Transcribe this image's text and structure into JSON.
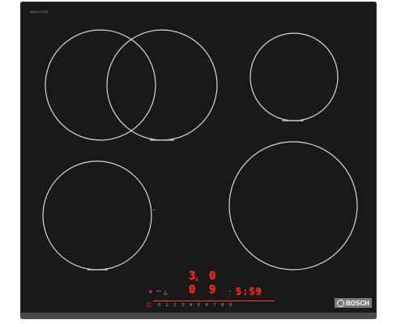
{
  "brand": {
    "top_left_line1": "INDUCTION",
    "top_left_line2": "",
    "top_right_line1": "",
    "top_right_line2": "",
    "logo_text": "BOSCH"
  },
  "colors": {
    "glass": "#191919",
    "zone_outline": "#d9d9d9",
    "display_red": "#ff2a2a",
    "logo_bg": "#7a7a7a"
  },
  "zones": [
    {
      "name": "front-left-flex-zone-a"
    },
    {
      "name": "front-left-flex-zone-b"
    },
    {
      "name": "top-right-zone"
    },
    {
      "name": "bottom-left-zone"
    },
    {
      "name": "bottom-right-zone"
    }
  ],
  "displays": {
    "top_left_level": "3",
    "top_left_sub": "A",
    "top_right_level": "0",
    "bottom_left_level": "0",
    "bottom_right_level": "9",
    "timer": "5:59"
  },
  "controls": {
    "slider_ticks": [
      "0",
      "1",
      "2",
      "3",
      "4",
      "5",
      "6",
      "7",
      "8",
      "9"
    ],
    "icons": [
      "lock-icon",
      "wifi-icon",
      "warning-icon"
    ],
    "power_icon": "power-icon",
    "timer_icon": "clock-icon"
  }
}
